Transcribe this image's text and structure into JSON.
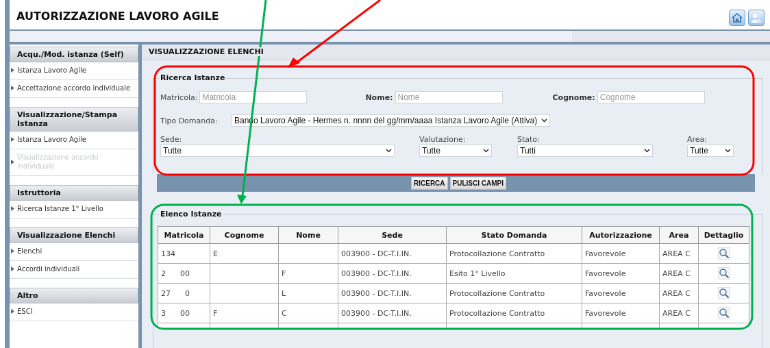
{
  "header": {
    "title": "AUTORIZZAZIONE LAVORO AGILE"
  },
  "sidebar": {
    "sections": [
      {
        "title": "Acqu./Mod. istanza (Self)",
        "items": [
          {
            "label": "Istanza Lavoro Agile",
            "disabled": false
          },
          {
            "label": "Accettazione accordo individuale",
            "disabled": false
          }
        ]
      },
      {
        "title": "Visualizzazione/Stampa Istanza",
        "items": [
          {
            "label": "Istanza Lavoro Agile",
            "disabled": false
          },
          {
            "label": "Visualizzazione accordo individuale",
            "disabled": true
          }
        ]
      },
      {
        "title": "Istruttoria",
        "items": [
          {
            "label": "Ricerca Istanze 1° Livello",
            "disabled": false
          }
        ]
      },
      {
        "title": "Visualizzazione Elenchi",
        "items": [
          {
            "label": "Elenchi",
            "disabled": false
          },
          {
            "label": "Accordi individuali",
            "disabled": false
          }
        ]
      },
      {
        "title": "Altro",
        "items": [
          {
            "label": "ESCI",
            "disabled": false
          }
        ]
      }
    ]
  },
  "page_title": "VISUALIZZAZIONE ELENCHI",
  "search": {
    "legend": "Ricerca Istanze",
    "matricola": {
      "label": "Matricola:",
      "placeholder": "Matricola"
    },
    "nome": {
      "label": "Nome:",
      "placeholder": "Nome"
    },
    "cognome": {
      "label": "Cognome:",
      "placeholder": "Cognome"
    },
    "tipo_domanda": {
      "label": "Tipo Domanda:",
      "value": "Bando Lavoro Agile - Hermes n. nnnn del gg/mm/aaaa Istanza Lavoro Agile (Attiva)"
    },
    "sede": {
      "label": "Sede:",
      "value": "Tutte"
    },
    "valutazione": {
      "label": "Valutazione:",
      "value": "Tutte"
    },
    "stato": {
      "label": "Stato:",
      "value": "Tutti"
    },
    "area": {
      "label": "Area:",
      "value": "Tutte"
    },
    "buttons": [
      "RICERCA",
      "PULISCI CAMPI"
    ]
  },
  "list": {
    "legend": "Elenco Istanze",
    "columns": [
      "Matricola",
      "Cognome",
      "Nome",
      "Sede",
      "Stato Domanda",
      "Autorizzazione",
      "Area",
      "Dettaglio"
    ],
    "rows": [
      {
        "cells": [
          "134",
          "E",
          "",
          "003900 - DC-T.I.IN.",
          "Protocollazione Contratto",
          "Favorevole",
          "AREA C"
        ]
      },
      {
        "cells": [
          "2      00",
          "",
          "F",
          "003900 - DC-T.I.IN.",
          "Esito 1° Livello",
          "Favorevole",
          "AREA C"
        ]
      },
      {
        "cells": [
          "27      0",
          "",
          "L",
          "003900 - DC-T.I.IN.",
          "Protocollazione Contratto",
          "Favorevole",
          "AREA C"
        ]
      },
      {
        "cells": [
          "3      00",
          "F",
          "C",
          "003900 - DC-T.I.IN.",
          "Protocollazione Contratto",
          "Favorevole",
          "AREA C"
        ]
      }
    ]
  },
  "annotations": [
    {
      "kind": "frame",
      "color": "#ff0000"
    },
    {
      "kind": "frame",
      "color": "#00b050"
    }
  ]
}
